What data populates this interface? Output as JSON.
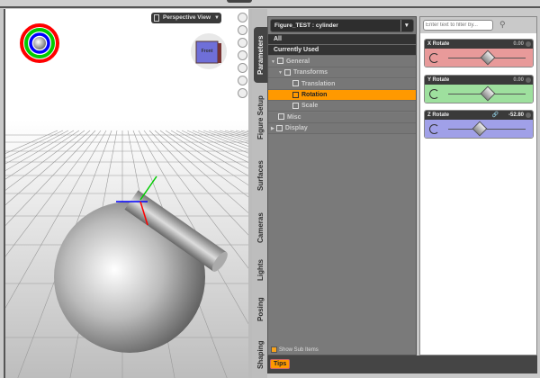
{
  "viewport": {
    "view_label": "Perspective View",
    "cube_label": "Front"
  },
  "side_tabs": [
    "Parameters",
    "Figure Setup",
    "Surfaces",
    "Cameras",
    "Lights",
    "Posing",
    "Shaping"
  ],
  "tree": {
    "node_selector": "Figure_TEST : cylinder",
    "rows": [
      {
        "label": "All",
        "type": "dark"
      },
      {
        "label": "Currently Used",
        "type": "dark"
      },
      {
        "label": "General",
        "type": "grp",
        "indent": 0,
        "arrow": "▼"
      },
      {
        "label": "Transforms",
        "type": "grp",
        "indent": 1,
        "arrow": "▼"
      },
      {
        "label": "Translation",
        "type": "grp",
        "indent": 2,
        "arrow": ""
      },
      {
        "label": "Rotation",
        "type": "sel",
        "indent": 2,
        "arrow": ""
      },
      {
        "label": "Scale",
        "type": "grp",
        "indent": 2,
        "arrow": ""
      },
      {
        "label": "Misc",
        "type": "grp",
        "indent": 1,
        "arrow": ""
      },
      {
        "label": "Display",
        "type": "grp",
        "indent": 0,
        "arrow": "▶"
      }
    ],
    "show_sub_items": "Show Sub Items"
  },
  "params": {
    "filter_placeholder": "Enter text to filter by...",
    "sliders": [
      {
        "label": "X Rotate",
        "value": "0.00",
        "fraction": 0.5,
        "color": "#e89a9a"
      },
      {
        "label": "Y Rotate",
        "value": "0.00",
        "fraction": 0.5,
        "color": "#9ee09e"
      },
      {
        "label": "Z Rotate",
        "value": "-52.80",
        "fraction": 0.4,
        "color": "#a0a0e8"
      }
    ]
  },
  "bottom": {
    "tips": "Tips"
  }
}
